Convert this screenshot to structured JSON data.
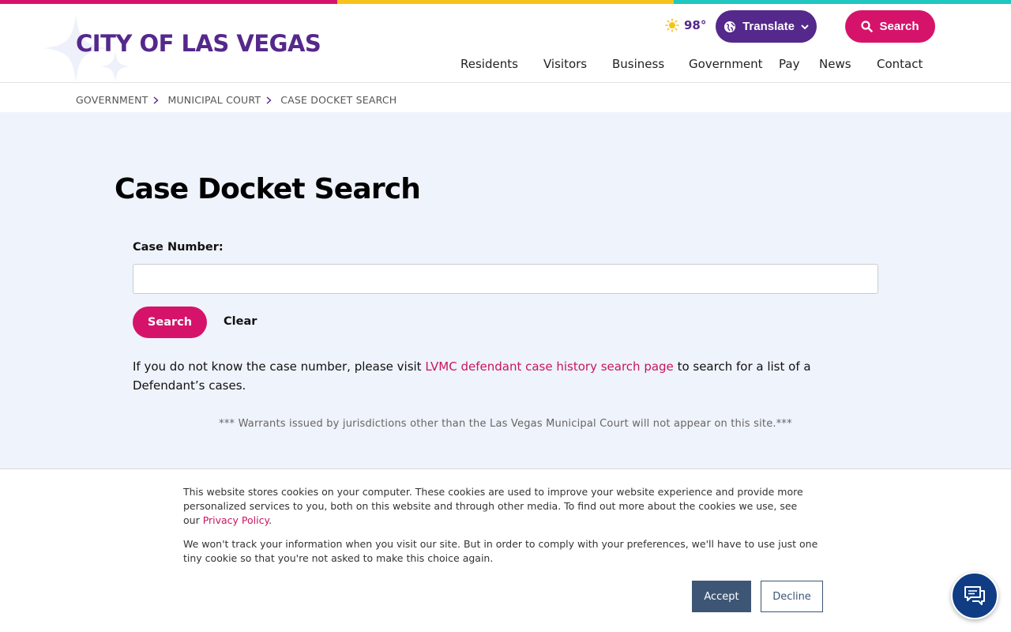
{
  "colors": {
    "brand_purple": "#55288c",
    "brand_pink": "#d6136b",
    "bar_pink": "#d6136b",
    "bar_yellow": "#f7c31a",
    "bar_teal": "#1fc7c0",
    "accept_button": "#3d5675",
    "chat_button": "#0f3c83",
    "main_bg": "#eff3fb"
  },
  "header": {
    "logo_text": "CITY OF LAS VEGAS",
    "weather": {
      "icon": "sun-icon",
      "temperature": "98°"
    },
    "translate_label": "Translate",
    "search_label": "Search",
    "nav": [
      "Residents",
      "Visitors",
      "Business",
      "Government",
      "Pay",
      "News",
      "Contact"
    ]
  },
  "breadcrumb": [
    "GOVERNMENT",
    "MUNICIPAL COURT",
    "CASE DOCKET SEARCH"
  ],
  "main": {
    "title": "Case Docket Search",
    "case_label": "Case Number:",
    "case_value": "",
    "search_button": "Search",
    "clear_button": "Clear",
    "help_before": "If you do not know the case number, please visit ",
    "help_link": "LVMC defendant case history search page",
    "help_after": " to search for a list of a Defendant’s cases.",
    "warrant_note": "*** Warrants issued by jurisdictions other than the Las Vegas Municipal Court will not appear on this site.***"
  },
  "cookie": {
    "text1": "This website stores cookies on your computer. These cookies are used to improve your website experience and provide more personalized services to you, both on this website and through other media. To find out more about the cookies we use, see our ",
    "privacy_link": "Privacy Policy",
    "text1_end": ".",
    "text2": "We won't track your information when you visit our site. But in order to comply with your preferences, we'll have to use just one tiny cookie so that you're not asked to make this choice again.",
    "accept": "Accept",
    "decline": "Decline"
  },
  "chat": {
    "icon": "chat-icon"
  }
}
